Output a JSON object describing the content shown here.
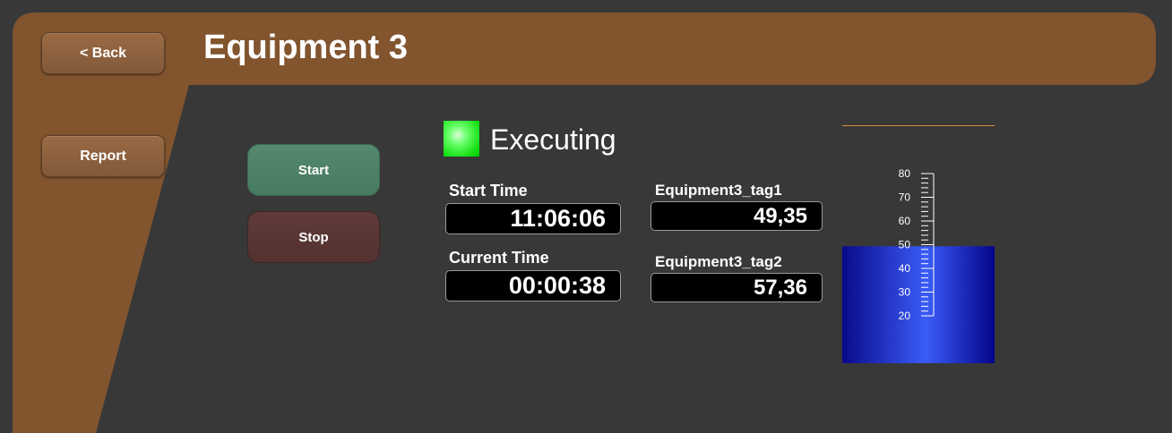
{
  "header": {
    "title": "Equipment 3",
    "back_label": "< Back",
    "report_label": "Report"
  },
  "controls": {
    "start_label": "Start",
    "stop_label": "Stop"
  },
  "status": {
    "text": "Executing",
    "light_color": "#00e000"
  },
  "fields": {
    "start_time_label": "Start Time",
    "start_time_value": "11:06:06",
    "current_time_label": "Current Time",
    "current_time_value": "00:00:38",
    "tag1_label": "Equipment3_tag1",
    "tag1_value": "49,35",
    "tag2_label": "Equipment3_tag2",
    "tag2_value": "57,36"
  },
  "tank": {
    "level": 49.35,
    "scale_labels": [
      "80",
      "70",
      "60",
      "50",
      "40",
      "30",
      "20"
    ],
    "fill_color": "#2f55f0"
  },
  "colors": {
    "brand": "#82552f",
    "background": "#383838",
    "accent_line": "#d98c3a"
  }
}
